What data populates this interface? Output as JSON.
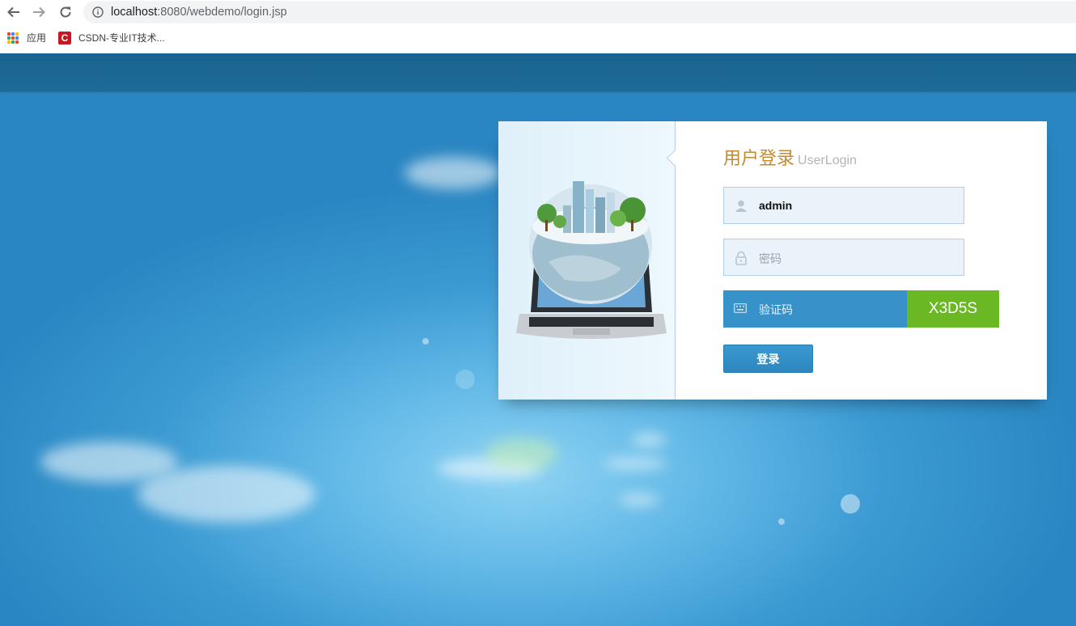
{
  "browser": {
    "url_host": "localhost",
    "url_rest": ":8080/webdemo/login.jsp",
    "nav": {
      "back_icon": "arrow-left-icon",
      "forward_icon": "arrow-right-icon",
      "reload_icon": "reload-icon",
      "info_icon": "info-icon"
    }
  },
  "bookmarks": [
    {
      "label": "应用",
      "icon": "apps-grid-icon"
    },
    {
      "label": "CSDN-专业IT技术...",
      "icon": "csdn-logo-icon",
      "logo_text": "C"
    }
  ],
  "login": {
    "title_cn": "用户登录",
    "title_en": "UserLogin",
    "username": {
      "value": "admin",
      "icon": "user-icon"
    },
    "password": {
      "placeholder": "密码",
      "icon": "lock-icon"
    },
    "captcha": {
      "placeholder": "验证码",
      "code": "X3D5S",
      "icon": "keyboard-icon"
    },
    "submit_label": "登录"
  },
  "colors": {
    "header": "#1a6390",
    "title": "#c58a2f",
    "captcha_bg": "#3792c9",
    "captcha_code_bg": "#6ab823",
    "button": "#3a98d0"
  }
}
